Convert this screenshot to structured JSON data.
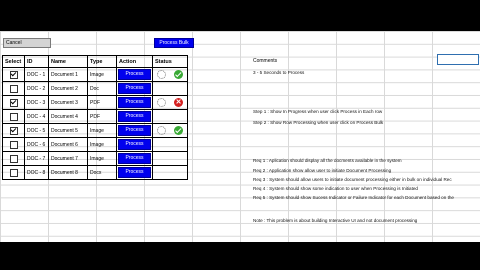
{
  "toolbar": {
    "cancel_label": "Cancel",
    "bulk_label": "Process Bulk"
  },
  "comments_label": "Comments",
  "table": {
    "headers": [
      "Select",
      "ID",
      "Name",
      "Type",
      "Action",
      "Status"
    ],
    "action_label": "Process",
    "rows": [
      {
        "checked": true,
        "id": "DOC - 1",
        "name": "Document 1",
        "type": "Image",
        "status": "success"
      },
      {
        "checked": false,
        "id": "DOC - 2",
        "name": "Document 2",
        "type": "Doc",
        "status": "none"
      },
      {
        "checked": true,
        "id": "DOC - 3",
        "name": "Document 3",
        "type": "PDF",
        "status": "failure"
      },
      {
        "checked": false,
        "id": "DOC - 4",
        "name": "Document 4",
        "type": "PDF",
        "status": "none"
      },
      {
        "checked": true,
        "id": "DOC - 5",
        "name": "Document 5",
        "type": "Image",
        "status": "success"
      },
      {
        "checked": false,
        "id": "DOC - 6",
        "name": "Document 6",
        "type": "Image",
        "status": "none"
      },
      {
        "checked": false,
        "id": "DOC - 7",
        "name": "Document 7",
        "type": "Image",
        "status": "none"
      },
      {
        "checked": false,
        "id": "DOC - 8",
        "name": "Document 8",
        "type": "Docx",
        "status": "none"
      }
    ]
  },
  "notes": {
    "timing": "3 - 5 Seconds to Process",
    "step1": "Step 1 :  Show In Progress when user click Process in Each row",
    "step2": "Step 2 :  Show Row Processing when user click on Process Bulk",
    "req1": "Req 1 : Aplication should display all the docments available in the system",
    "req2": "Req 2 : Application show allow user to initiate Document Processing",
    "req3": "Req 3 : System should allow users to initiate document processing either in bulk on individual Rec",
    "req4": "Req 4 : System should show some indication to user when Processing is Initiated",
    "req5": "Req 5 : System should show Sucess Indicator or Failure Indicator for each Document based on the",
    "note": "Note : This problem is about building Interactive UI and not document processing"
  }
}
